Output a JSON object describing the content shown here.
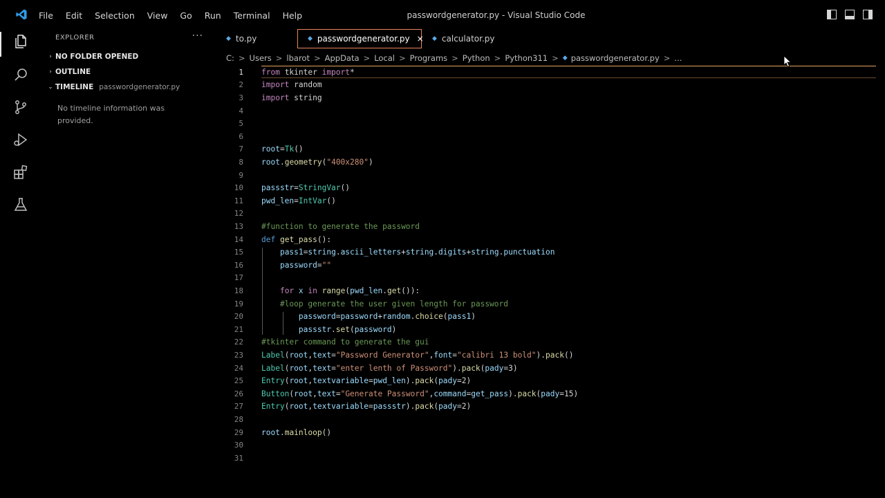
{
  "titlebar": {
    "menu": [
      "File",
      "Edit",
      "Selection",
      "View",
      "Go",
      "Run",
      "Terminal",
      "Help"
    ],
    "window_title": "passwordgenerator.py - Visual Studio Code"
  },
  "activitybar": {
    "icons": [
      "files-icon",
      "search-icon",
      "source-control-icon",
      "run-debug-icon",
      "extensions-icon",
      "testing-icon"
    ]
  },
  "sidebar": {
    "title": "EXPLORER",
    "more": "···",
    "sections": [
      {
        "label": "NO FOLDER OPENED",
        "chevron": "›",
        "sub": ""
      },
      {
        "label": "OUTLINE",
        "chevron": "›",
        "sub": ""
      },
      {
        "label": "TIMELINE",
        "chevron": "⌄",
        "sub": "passwordgenerator.py"
      }
    ],
    "timeline_message": "No timeline information was provided."
  },
  "tabs": [
    {
      "label": "to.py",
      "active": false
    },
    {
      "label": "passwordgenerator.py",
      "active": true,
      "close": "×"
    },
    {
      "label": "calculator.py",
      "active": false
    }
  ],
  "breadcrumb": {
    "parts": [
      "C:",
      "Users",
      "lbarot",
      "AppData",
      "Local",
      "Programs",
      "Python",
      "Python311"
    ],
    "file": "passwordgenerator.py",
    "tail": "..."
  },
  "editor": {
    "current_line": 1,
    "lines": [
      {
        "n": "1",
        "tokens": [
          [
            "k",
            "from"
          ],
          [
            "p",
            " tkinter "
          ],
          [
            "k",
            "import"
          ],
          [
            "p",
            "*"
          ]
        ]
      },
      {
        "n": "2",
        "tokens": [
          [
            "k",
            "import"
          ],
          [
            "p",
            " random"
          ]
        ]
      },
      {
        "n": "3",
        "tokens": [
          [
            "k",
            "import"
          ],
          [
            "p",
            " string"
          ]
        ]
      },
      {
        "n": "4",
        "tokens": []
      },
      {
        "n": "5",
        "tokens": []
      },
      {
        "n": "6",
        "tokens": []
      },
      {
        "n": "7",
        "tokens": [
          [
            "v",
            "root"
          ],
          [
            "p",
            "="
          ],
          [
            "t",
            "Tk"
          ],
          [
            "p",
            "()"
          ]
        ]
      },
      {
        "n": "8",
        "tokens": [
          [
            "v",
            "root"
          ],
          [
            "p",
            "."
          ],
          [
            "f",
            "geometry"
          ],
          [
            "p",
            "("
          ],
          [
            "s",
            "\"400x280\""
          ],
          [
            "p",
            ")"
          ]
        ]
      },
      {
        "n": "9",
        "tokens": []
      },
      {
        "n": "10",
        "tokens": [
          [
            "v",
            "passstr"
          ],
          [
            "p",
            "="
          ],
          [
            "t",
            "StringVar"
          ],
          [
            "p",
            "()"
          ]
        ]
      },
      {
        "n": "11",
        "tokens": [
          [
            "v",
            "pwd_len"
          ],
          [
            "p",
            "="
          ],
          [
            "t",
            "IntVar"
          ],
          [
            "p",
            "()"
          ]
        ]
      },
      {
        "n": "12",
        "tokens": []
      },
      {
        "n": "13",
        "tokens": [
          [
            "c",
            "#function to generate the password"
          ]
        ]
      },
      {
        "n": "14",
        "tokens": [
          [
            "b",
            "def"
          ],
          [
            "p",
            " "
          ],
          [
            "f",
            "get_pass"
          ],
          [
            "p",
            "():"
          ]
        ]
      },
      {
        "n": "15",
        "tokens": [
          [
            "p",
            "    "
          ],
          [
            "v",
            "pass1"
          ],
          [
            "p",
            "="
          ],
          [
            "v",
            "string"
          ],
          [
            "p",
            "."
          ],
          [
            "v",
            "ascii_letters"
          ],
          [
            "p",
            "+"
          ],
          [
            "v",
            "string"
          ],
          [
            "p",
            "."
          ],
          [
            "v",
            "digits"
          ],
          [
            "p",
            "+"
          ],
          [
            "v",
            "string"
          ],
          [
            "p",
            "."
          ],
          [
            "v",
            "punctuation"
          ]
        ]
      },
      {
        "n": "16",
        "tokens": [
          [
            "p",
            "    "
          ],
          [
            "v",
            "password"
          ],
          [
            "p",
            "="
          ],
          [
            "s",
            "\"\""
          ]
        ]
      },
      {
        "n": "17",
        "tokens": []
      },
      {
        "n": "18",
        "tokens": [
          [
            "p",
            "    "
          ],
          [
            "k",
            "for"
          ],
          [
            "p",
            " "
          ],
          [
            "v",
            "x"
          ],
          [
            "p",
            " "
          ],
          [
            "k",
            "in"
          ],
          [
            "p",
            " "
          ],
          [
            "f",
            "range"
          ],
          [
            "p",
            "("
          ],
          [
            "v",
            "pwd_len"
          ],
          [
            "p",
            "."
          ],
          [
            "f",
            "get"
          ],
          [
            "p",
            "()):"
          ]
        ]
      },
      {
        "n": "19",
        "tokens": [
          [
            "p",
            "    "
          ],
          [
            "c",
            "#loop generate the user given length for password"
          ]
        ]
      },
      {
        "n": "20",
        "tokens": [
          [
            "p",
            "        "
          ],
          [
            "v",
            "password"
          ],
          [
            "p",
            "="
          ],
          [
            "v",
            "password"
          ],
          [
            "p",
            "+"
          ],
          [
            "v",
            "random"
          ],
          [
            "p",
            "."
          ],
          [
            "f",
            "choice"
          ],
          [
            "p",
            "("
          ],
          [
            "v",
            "pass1"
          ],
          [
            "p",
            ")"
          ]
        ]
      },
      {
        "n": "21",
        "tokens": [
          [
            "p",
            "        "
          ],
          [
            "v",
            "passstr"
          ],
          [
            "p",
            "."
          ],
          [
            "f",
            "set"
          ],
          [
            "p",
            "("
          ],
          [
            "v",
            "password"
          ],
          [
            "p",
            ")"
          ]
        ]
      },
      {
        "n": "22",
        "tokens": [
          [
            "c",
            "#tkinter command to generate the gui"
          ]
        ]
      },
      {
        "n": "23",
        "tokens": [
          [
            "t",
            "Label"
          ],
          [
            "p",
            "("
          ],
          [
            "v",
            "root"
          ],
          [
            "p",
            ","
          ],
          [
            "v",
            "text"
          ],
          [
            "p",
            "="
          ],
          [
            "s",
            "\"Password Generator\""
          ],
          [
            "p",
            ","
          ],
          [
            "v",
            "font"
          ],
          [
            "p",
            "="
          ],
          [
            "s",
            "\"calibri 13 bold\""
          ],
          [
            "p",
            ")."
          ],
          [
            "f",
            "pack"
          ],
          [
            "p",
            "()"
          ]
        ]
      },
      {
        "n": "24",
        "tokens": [
          [
            "t",
            "Label"
          ],
          [
            "p",
            "("
          ],
          [
            "v",
            "root"
          ],
          [
            "p",
            ","
          ],
          [
            "v",
            "text"
          ],
          [
            "p",
            "="
          ],
          [
            "s",
            "\"enter lenth of Password\""
          ],
          [
            "p",
            ")."
          ],
          [
            "f",
            "pack"
          ],
          [
            "p",
            "("
          ],
          [
            "v",
            "pady"
          ],
          [
            "p",
            "=3)"
          ]
        ]
      },
      {
        "n": "25",
        "tokens": [
          [
            "t",
            "Entry"
          ],
          [
            "p",
            "("
          ],
          [
            "v",
            "root"
          ],
          [
            "p",
            ","
          ],
          [
            "v",
            "textvariable"
          ],
          [
            "p",
            "="
          ],
          [
            "v",
            "pwd_len"
          ],
          [
            "p",
            ")."
          ],
          [
            "f",
            "pack"
          ],
          [
            "p",
            "("
          ],
          [
            "v",
            "pady"
          ],
          [
            "p",
            "=2)"
          ]
        ]
      },
      {
        "n": "26",
        "tokens": [
          [
            "t",
            "Button"
          ],
          [
            "p",
            "("
          ],
          [
            "v",
            "root"
          ],
          [
            "p",
            ","
          ],
          [
            "v",
            "text"
          ],
          [
            "p",
            "="
          ],
          [
            "s",
            "\"Generate Password\""
          ],
          [
            "p",
            ","
          ],
          [
            "v",
            "command"
          ],
          [
            "p",
            "="
          ],
          [
            "v",
            "get_pass"
          ],
          [
            "p",
            ")."
          ],
          [
            "f",
            "pack"
          ],
          [
            "p",
            "("
          ],
          [
            "v",
            "pady"
          ],
          [
            "p",
            "=15)"
          ]
        ]
      },
      {
        "n": "27",
        "tokens": [
          [
            "t",
            "Entry"
          ],
          [
            "p",
            "("
          ],
          [
            "v",
            "root"
          ],
          [
            "p",
            ","
          ],
          [
            "v",
            "textvariable"
          ],
          [
            "p",
            "="
          ],
          [
            "v",
            "passstr"
          ],
          [
            "p",
            ")."
          ],
          [
            "f",
            "pack"
          ],
          [
            "p",
            "("
          ],
          [
            "v",
            "pady"
          ],
          [
            "p",
            "=2)"
          ]
        ]
      },
      {
        "n": "28",
        "tokens": []
      },
      {
        "n": "29",
        "tokens": [
          [
            "v",
            "root"
          ],
          [
            "p",
            "."
          ],
          [
            "f",
            "mainloop"
          ],
          [
            "p",
            "()"
          ]
        ]
      },
      {
        "n": "30",
        "tokens": []
      },
      {
        "n": "31",
        "tokens": []
      }
    ]
  }
}
